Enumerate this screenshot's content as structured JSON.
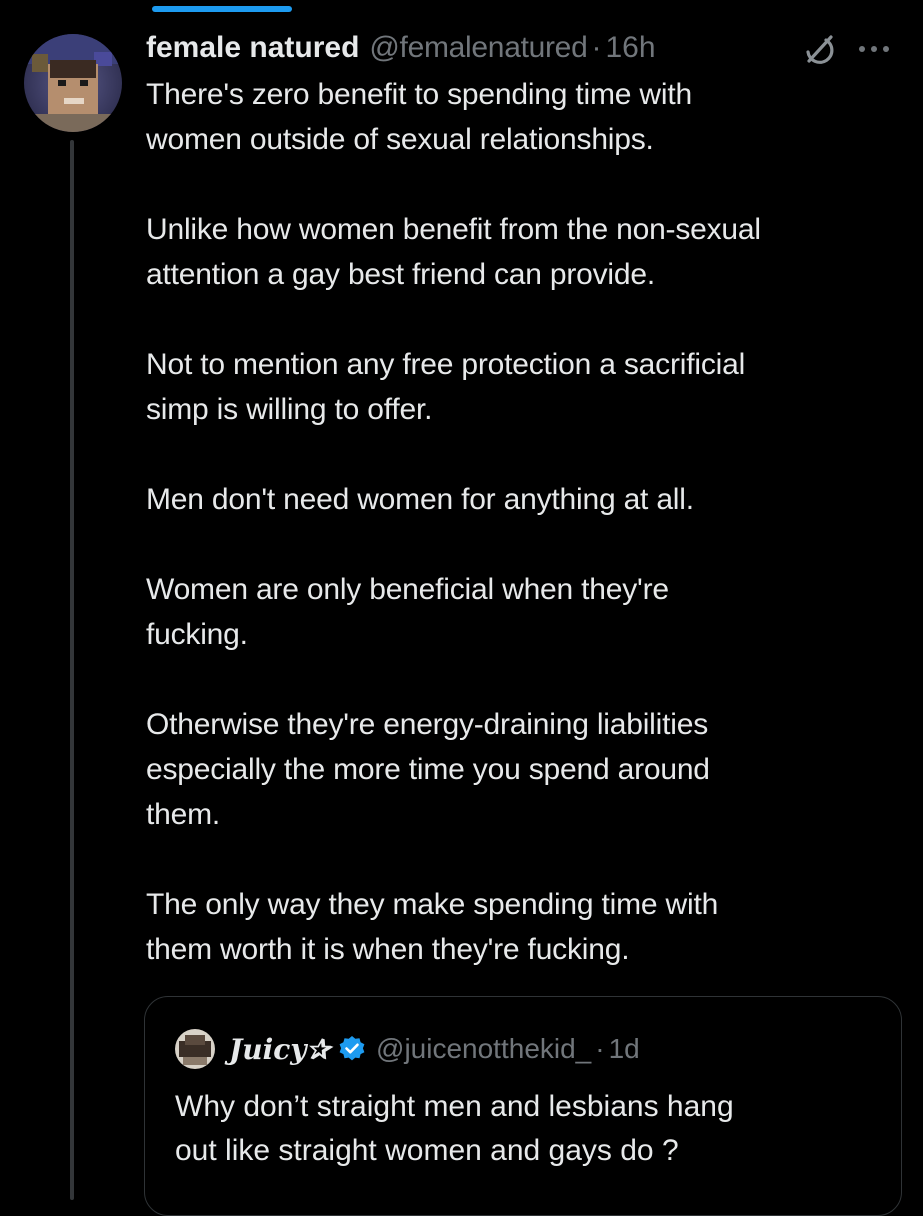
{
  "colors": {
    "background": "#000000",
    "text_primary": "#e7e9ea",
    "text_secondary": "#71767b",
    "accent": "#1d9bf0",
    "border": "#2f3336"
  },
  "tweet": {
    "display_name": "female natured",
    "handle": "@femalenatured",
    "separator": "·",
    "time": "16h",
    "icons": [
      "grok-icon",
      "more-icon"
    ],
    "paragraphs": [
      [
        "There's zero benefit to spending time with",
        "women outside of sexual relationships."
      ],
      [
        "Unlike how women benefit from the non-sexual",
        "attention a gay best friend can provide."
      ],
      [
        "Not to mention any free protection a sacrificial",
        "simp is willing to offer."
      ],
      [
        "Men don't need women for anything at all."
      ],
      [
        "Women are only beneficial when they're",
        "fucking."
      ],
      [
        "Otherwise they're energy-draining liabilities",
        "especially the more time you spend around",
        "them."
      ],
      [
        "The only way they make spending time with",
        "them worth it is when they're fucking."
      ]
    ]
  },
  "quoted_tweet": {
    "display_name": "Juicy✰",
    "verified": true,
    "handle": "@juicenotthekid_",
    "separator": "·",
    "time": "1d",
    "lines": [
      "Why don’t straight men and lesbians hang",
      "out like straight women and gays do ?"
    ]
  }
}
